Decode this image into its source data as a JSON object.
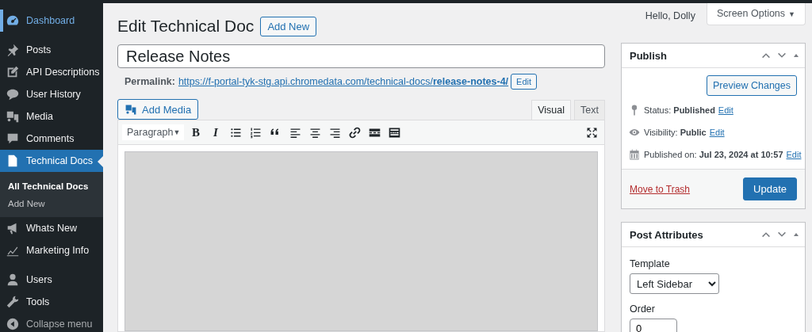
{
  "sidebar": {
    "items": [
      {
        "label": "Dashboard",
        "selected": false,
        "hovered": true
      },
      {
        "label": "Posts",
        "selected": false,
        "hovered": false
      },
      {
        "label": "API Descriptions",
        "selected": false,
        "hovered": false
      },
      {
        "label": "User History",
        "selected": false,
        "hovered": false
      },
      {
        "label": "Media",
        "selected": false,
        "hovered": false
      },
      {
        "label": "Comments",
        "selected": false,
        "hovered": false
      },
      {
        "label": "Technical Docs",
        "selected": true,
        "hovered": false,
        "children": [
          {
            "label": "All Technical Docs",
            "selected": true
          },
          {
            "label": "Add New",
            "selected": false
          }
        ]
      },
      {
        "label": "Whats New",
        "selected": false,
        "hovered": false
      },
      {
        "label": "Marketing Info",
        "selected": false,
        "hovered": false
      },
      {
        "label": "Users",
        "selected": false,
        "hovered": false
      },
      {
        "label": "Tools",
        "selected": false,
        "hovered": false
      },
      {
        "label": "Collapse menu",
        "selected": false,
        "hovered": false
      }
    ]
  },
  "header": {
    "greeting": "Hello, Dolly",
    "screen_options": "Screen Options",
    "screen_options_caret": "▼"
  },
  "page": {
    "title": "Edit Technical Doc",
    "add_new": "Add New"
  },
  "post_title": {
    "value": "Release Notes"
  },
  "permalink": {
    "label": "Permalink:",
    "url_base": "https://f-portal-tyk-stg.api.chromedata.com/technical-docs/",
    "slug": "release-notes-4/",
    "edit": "Edit"
  },
  "editor": {
    "add_media": "Add Media",
    "tabs": [
      {
        "label": "Visual",
        "selected": true
      },
      {
        "label": "Text",
        "selected": false
      }
    ],
    "toolbar": [
      {
        "kind": "format",
        "label": "Paragraph",
        "caret": "▼"
      },
      {
        "kind": "bold",
        "label": "B"
      },
      {
        "kind": "italic",
        "label": "I"
      },
      {
        "kind": "bullets"
      },
      {
        "kind": "numbers"
      },
      {
        "kind": "quote"
      },
      {
        "kind": "align-left"
      },
      {
        "kind": "align-center"
      },
      {
        "kind": "align-right"
      },
      {
        "kind": "link"
      },
      {
        "kind": "more"
      },
      {
        "kind": "keyboard"
      },
      {
        "kind": "fullscreen"
      }
    ]
  },
  "publish": {
    "title": "Publish",
    "preview": "Preview Changes",
    "rows": [
      {
        "label": "Status:",
        "value": "Published",
        "link": "Edit"
      },
      {
        "label": "Visibility:",
        "value": "Public",
        "link": "Edit"
      },
      {
        "label": "Published on:",
        "value": "Jul 23, 2024 at 10:57",
        "link": "Edit"
      }
    ],
    "trash": "Move to Trash",
    "update": "Update"
  },
  "post_attributes": {
    "title": "Post Attributes",
    "template_label": "Template",
    "template": "Left Sidebar",
    "order_label": "Order",
    "order": "0"
  }
}
